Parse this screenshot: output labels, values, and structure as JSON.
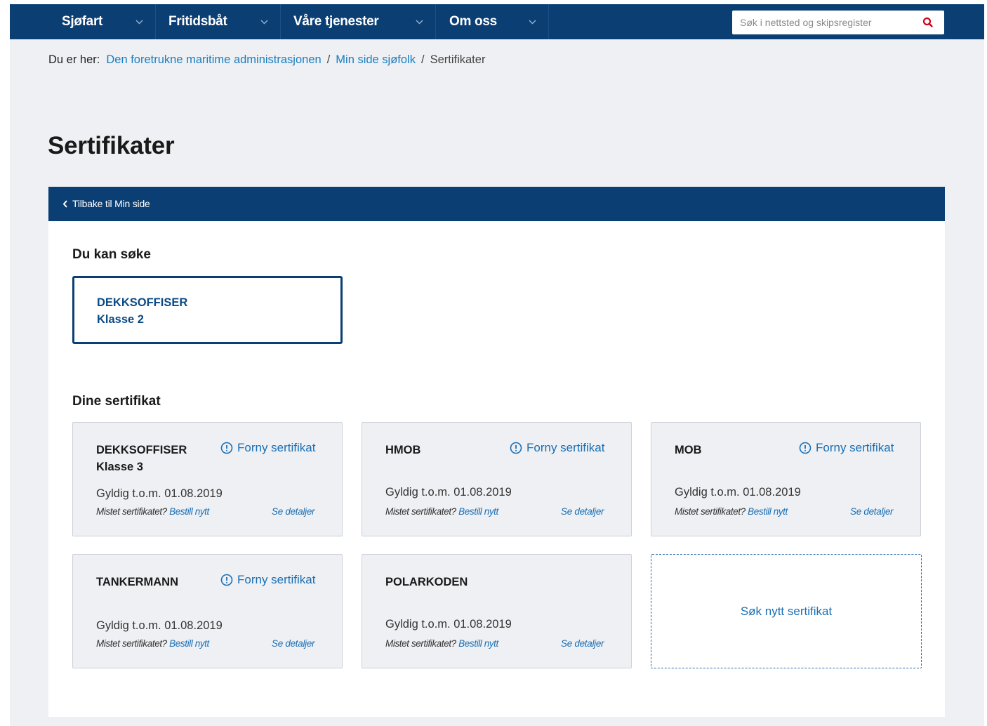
{
  "nav": {
    "items": [
      {
        "label": "Sjøfart"
      },
      {
        "label": "Fritidsbåt"
      },
      {
        "label": "Våre tjenester"
      },
      {
        "label": "Om oss"
      }
    ],
    "search_placeholder": "Søk i nettsted og skipsregister"
  },
  "breadcrumb": {
    "lead": "Du er her:",
    "links": [
      "Den foretrukne maritime administrasjonen",
      "Min side sjøfolk"
    ],
    "separator": "/",
    "current": "Sertifikater"
  },
  "page": {
    "title": "Sertifikater",
    "back_label": "Tilbake til Min side"
  },
  "apply": {
    "heading": "Du kan søke",
    "cards": [
      {
        "line1": "DEKKSOFFISER",
        "line2": "Klasse 2"
      }
    ]
  },
  "certs": {
    "heading": "Dine sertifikat",
    "renew_label": "Forny sertifikat",
    "lost_text": "Mistet sertifikatet?",
    "order_label": "Bestill nytt",
    "details_label": "Se detaljer",
    "items": [
      {
        "name_line1": "DEKKSOFFISER",
        "name_line2": "Klasse 3",
        "valid": "Gyldig t.o.m. 01.08.2019"
      },
      {
        "name_line1": "HMOB",
        "name_line2": "",
        "valid": "Gyldig t.o.m. 01.08.2019"
      },
      {
        "name_line1": "MOB",
        "name_line2": "",
        "valid": "Gyldig t.o.m. 01.08.2019"
      },
      {
        "name_line1": "TANKERMANN",
        "name_line2": "",
        "valid": "Gyldig t.o.m. 01.08.2019"
      },
      {
        "name_line1": "POLARKODEN",
        "name_line2": "",
        "valid": "Gyldig t.o.m. 01.08.2019"
      }
    ],
    "new_label": "Søk nytt sertifikat"
  },
  "colors": {
    "brand_navy": "#0b3e73",
    "link_blue": "#1a6fb5",
    "search_accent": "#d0021b"
  },
  "icons": {
    "nav_dropdown": "chevron-down-icon",
    "search": "search-icon",
    "back": "chevron-left-icon",
    "renew": "alert-circle-icon"
  }
}
